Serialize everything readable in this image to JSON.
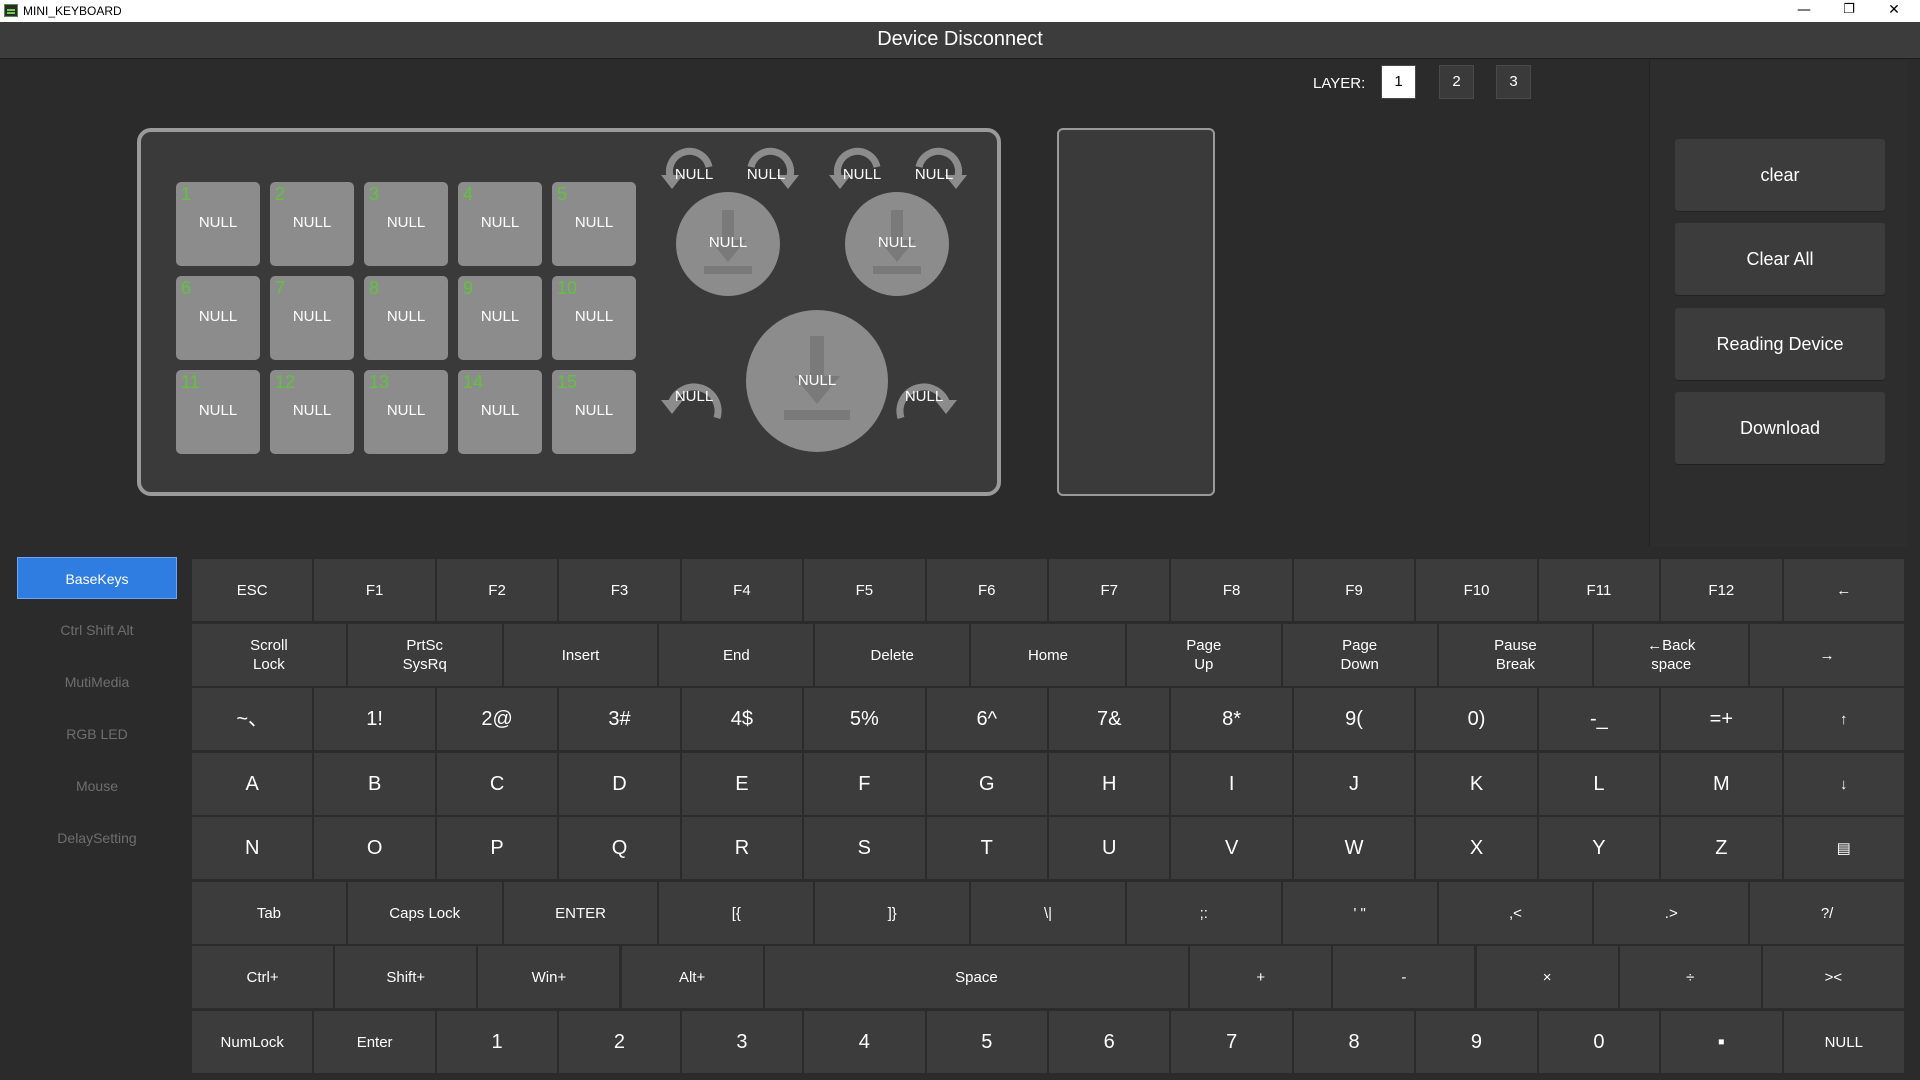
{
  "window": {
    "title": "MINI_KEYBOARD",
    "minimize": "—",
    "restore": "❐",
    "close": "✕"
  },
  "header": {
    "status": "Device Disconnect"
  },
  "layer": {
    "label": "LAYER:",
    "buttons": [
      "1",
      "2",
      "3"
    ],
    "active": "1"
  },
  "actions": [
    "clear",
    "Clear All",
    "Reading Device",
    "Download"
  ],
  "pads": [
    {
      "num": "1",
      "label": "NULL"
    },
    {
      "num": "2",
      "label": "NULL"
    },
    {
      "num": "3",
      "label": "NULL"
    },
    {
      "num": "4",
      "label": "NULL"
    },
    {
      "num": "5",
      "label": "NULL"
    },
    {
      "num": "6",
      "label": "NULL"
    },
    {
      "num": "7",
      "label": "NULL"
    },
    {
      "num": "8",
      "label": "NULL"
    },
    {
      "num": "9",
      "label": "NULL"
    },
    {
      "num": "10",
      "label": "NULL"
    },
    {
      "num": "11",
      "label": "NULL"
    },
    {
      "num": "12",
      "label": "NULL"
    },
    {
      "num": "13",
      "label": "NULL"
    },
    {
      "num": "14",
      "label": "NULL"
    },
    {
      "num": "15",
      "label": "NULL"
    }
  ],
  "knobs": {
    "knob1": {
      "press": "NULL",
      "left": "NULL",
      "right": "NULL"
    },
    "knob2": {
      "press": "NULL",
      "left": "NULL",
      "right": "NULL"
    },
    "knob3": {
      "press": "NULL",
      "left": "NULL",
      "right": "NULL"
    }
  },
  "sidebar": {
    "items": [
      "BaseKeys",
      "Ctrl Shift Alt",
      "MutiMedia",
      "RGB LED",
      "Mouse",
      "DelaySetting"
    ],
    "active": "BaseKeys"
  },
  "keyboard": {
    "rows": [
      [
        "ESC",
        "F1",
        "F2",
        "F3",
        "F4",
        "F5",
        "F6",
        "F7",
        "F8",
        "F9",
        "F10",
        "F11",
        "F12",
        "←"
      ],
      [
        "Scroll\nLock",
        "PrtSc\nSysRq",
        "Insert",
        "End",
        "Delete",
        "Home",
        "Page\nUp",
        "Page\nDown",
        "Pause\nBreak",
        "←Back\nspace",
        "→"
      ],
      [
        "~、",
        "1!",
        "2@",
        "3#",
        "4$",
        "5%",
        "6^",
        "7&",
        "8*",
        "9(",
        "0)",
        "-_",
        "=+",
        "↑"
      ],
      [
        "A",
        "B",
        "C",
        "D",
        "E",
        "F",
        "G",
        "H",
        "I",
        "J",
        "K",
        "L",
        "M",
        "↓"
      ],
      [
        "N",
        "O",
        "P",
        "Q",
        "R",
        "S",
        "T",
        "U",
        "V",
        "W",
        "X",
        "Y",
        "Z",
        "▤"
      ],
      [
        "Tab",
        "Caps Lock",
        "ENTER",
        "[{",
        "]}",
        "\\|",
        ";:",
        "' \"",
        ",<",
        ".>",
        "?/"
      ],
      [
        "Ctrl+",
        "Shift+",
        "Win+",
        "Alt+",
        "Space",
        "+",
        "-",
        "×",
        "÷",
        "><"
      ],
      [
        "NumLock",
        "Enter",
        "1",
        "2",
        "3",
        "4",
        "5",
        "6",
        "7",
        "8",
        "9",
        "0",
        "▪",
        "NULL"
      ]
    ]
  }
}
